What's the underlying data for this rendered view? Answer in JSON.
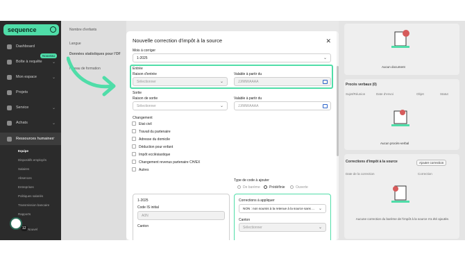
{
  "colors": {
    "accent": "#4fdda8",
    "sidebar": "#2b2b2b",
    "calendar_icon": "#2b63c9"
  },
  "sidebar": {
    "logo": "sequence",
    "items": [
      {
        "label": "Dashboard",
        "icon": "dashboard-icon"
      },
      {
        "label": "Boîte à requête",
        "icon": "inbox-icon",
        "badge": "Nouveau"
      },
      {
        "label": "Mon espace",
        "icon": "user-icon"
      },
      {
        "label": "Projets",
        "icon": "folder-icon"
      },
      {
        "label": "Service",
        "icon": "service-icon"
      },
      {
        "label": "Achats",
        "icon": "cart-icon"
      },
      {
        "label": "Ressources humaines",
        "icon": "people-icon"
      }
    ],
    "subitems": [
      "Equipe",
      "Dispositifs employés",
      "Salaires",
      "Absences",
      "Entreprises",
      "Politiques salariés",
      "Transmission bancaire",
      "Rapports"
    ],
    "bottom_item": "Nouvel",
    "fab_count": "12"
  },
  "background": {
    "left_labels": [
      "Nombre d'enfants",
      "Langue",
      "Données statistiques pour l'OF",
      "Niveau de formation"
    ],
    "right": {
      "doc_empty": "Aucun document",
      "verbal_title": "Procès verbaux (0)",
      "verbal_columns": [
        "Sujet/Réunion",
        "Date d'envoi",
        "Objet",
        "Statut"
      ],
      "verbal_empty": "Aucun procès-verbal",
      "tax_title": "Corrections d'impôt à la source",
      "tax_button": "Ajouter correction",
      "tax_columns": [
        "Date de la correction",
        "Correction"
      ],
      "tax_empty": "Aucune correction du barème de l'impôt à la source n'a été ajoutée."
    }
  },
  "modal": {
    "title": "Nouvelle correction d'impôt à la source",
    "month_label": "Mois à corriger",
    "month_value": "1-2025",
    "entry": {
      "section": "Entrée",
      "reason_label": "Raison d'entrée",
      "reason_placeholder": "Sélectionner",
      "date_label": "Valable à partir du",
      "date_placeholder": "JJ/MM/AAAA"
    },
    "exit": {
      "section": "Sortie",
      "reason_label": "Raison de sortie",
      "reason_placeholder": "Sélectionner",
      "date_label": "Valable à partir du",
      "date_placeholder": "JJ/MM/AAAA"
    },
    "changes": {
      "section": "Changement",
      "options": [
        "Etat civil",
        "Travail du partenaire",
        "Adresse du domicile",
        "Déduction pour enfant",
        "Impôt ecclésiastique",
        "Changement revenus partenaire CH/EX",
        "Autres"
      ]
    },
    "code_type": {
      "label": "Type de code à ajouter",
      "options": [
        "De barème",
        "Prédéfinie",
        "Ouverte"
      ],
      "selected": "Prédéfinie"
    },
    "left_box": {
      "period": "1-2025",
      "code_label": "Code IS initial",
      "code_value": "A0N",
      "canton_label": "Canton"
    },
    "right_box": {
      "corrections_label": "Corrections à appliquer",
      "corrections_value": "NON : non soumis à la retenue à la source sans ...",
      "canton_label": "Canton",
      "canton_placeholder": "Sélectionner"
    }
  }
}
